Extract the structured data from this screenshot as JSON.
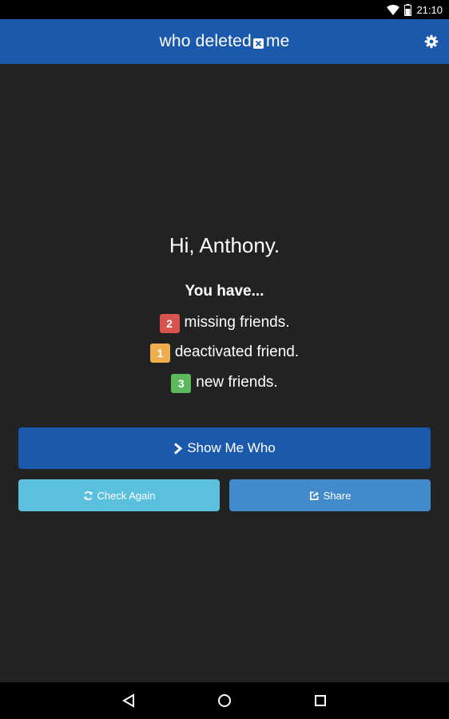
{
  "status_bar": {
    "time": "21:10"
  },
  "app_bar": {
    "logo_left": "who deleted",
    "logo_right": "me"
  },
  "main": {
    "greeting": "Hi, Anthony.",
    "you_have": "You have...",
    "stats": [
      {
        "count": "2",
        "label": "missing friends.",
        "color": "#d9534f"
      },
      {
        "count": "1",
        "label": "deactivated friend.",
        "color": "#f0ad4e"
      },
      {
        "count": "3",
        "label": "new friends.",
        "color": "#5cb85c"
      }
    ]
  },
  "buttons": {
    "show_me_who": "Show Me Who",
    "check_again": "Check Again",
    "share": "Share"
  },
  "colors": {
    "brand": "#1b59ad",
    "background": "#222222",
    "info": "#5bc0de",
    "share": "#428bca"
  }
}
